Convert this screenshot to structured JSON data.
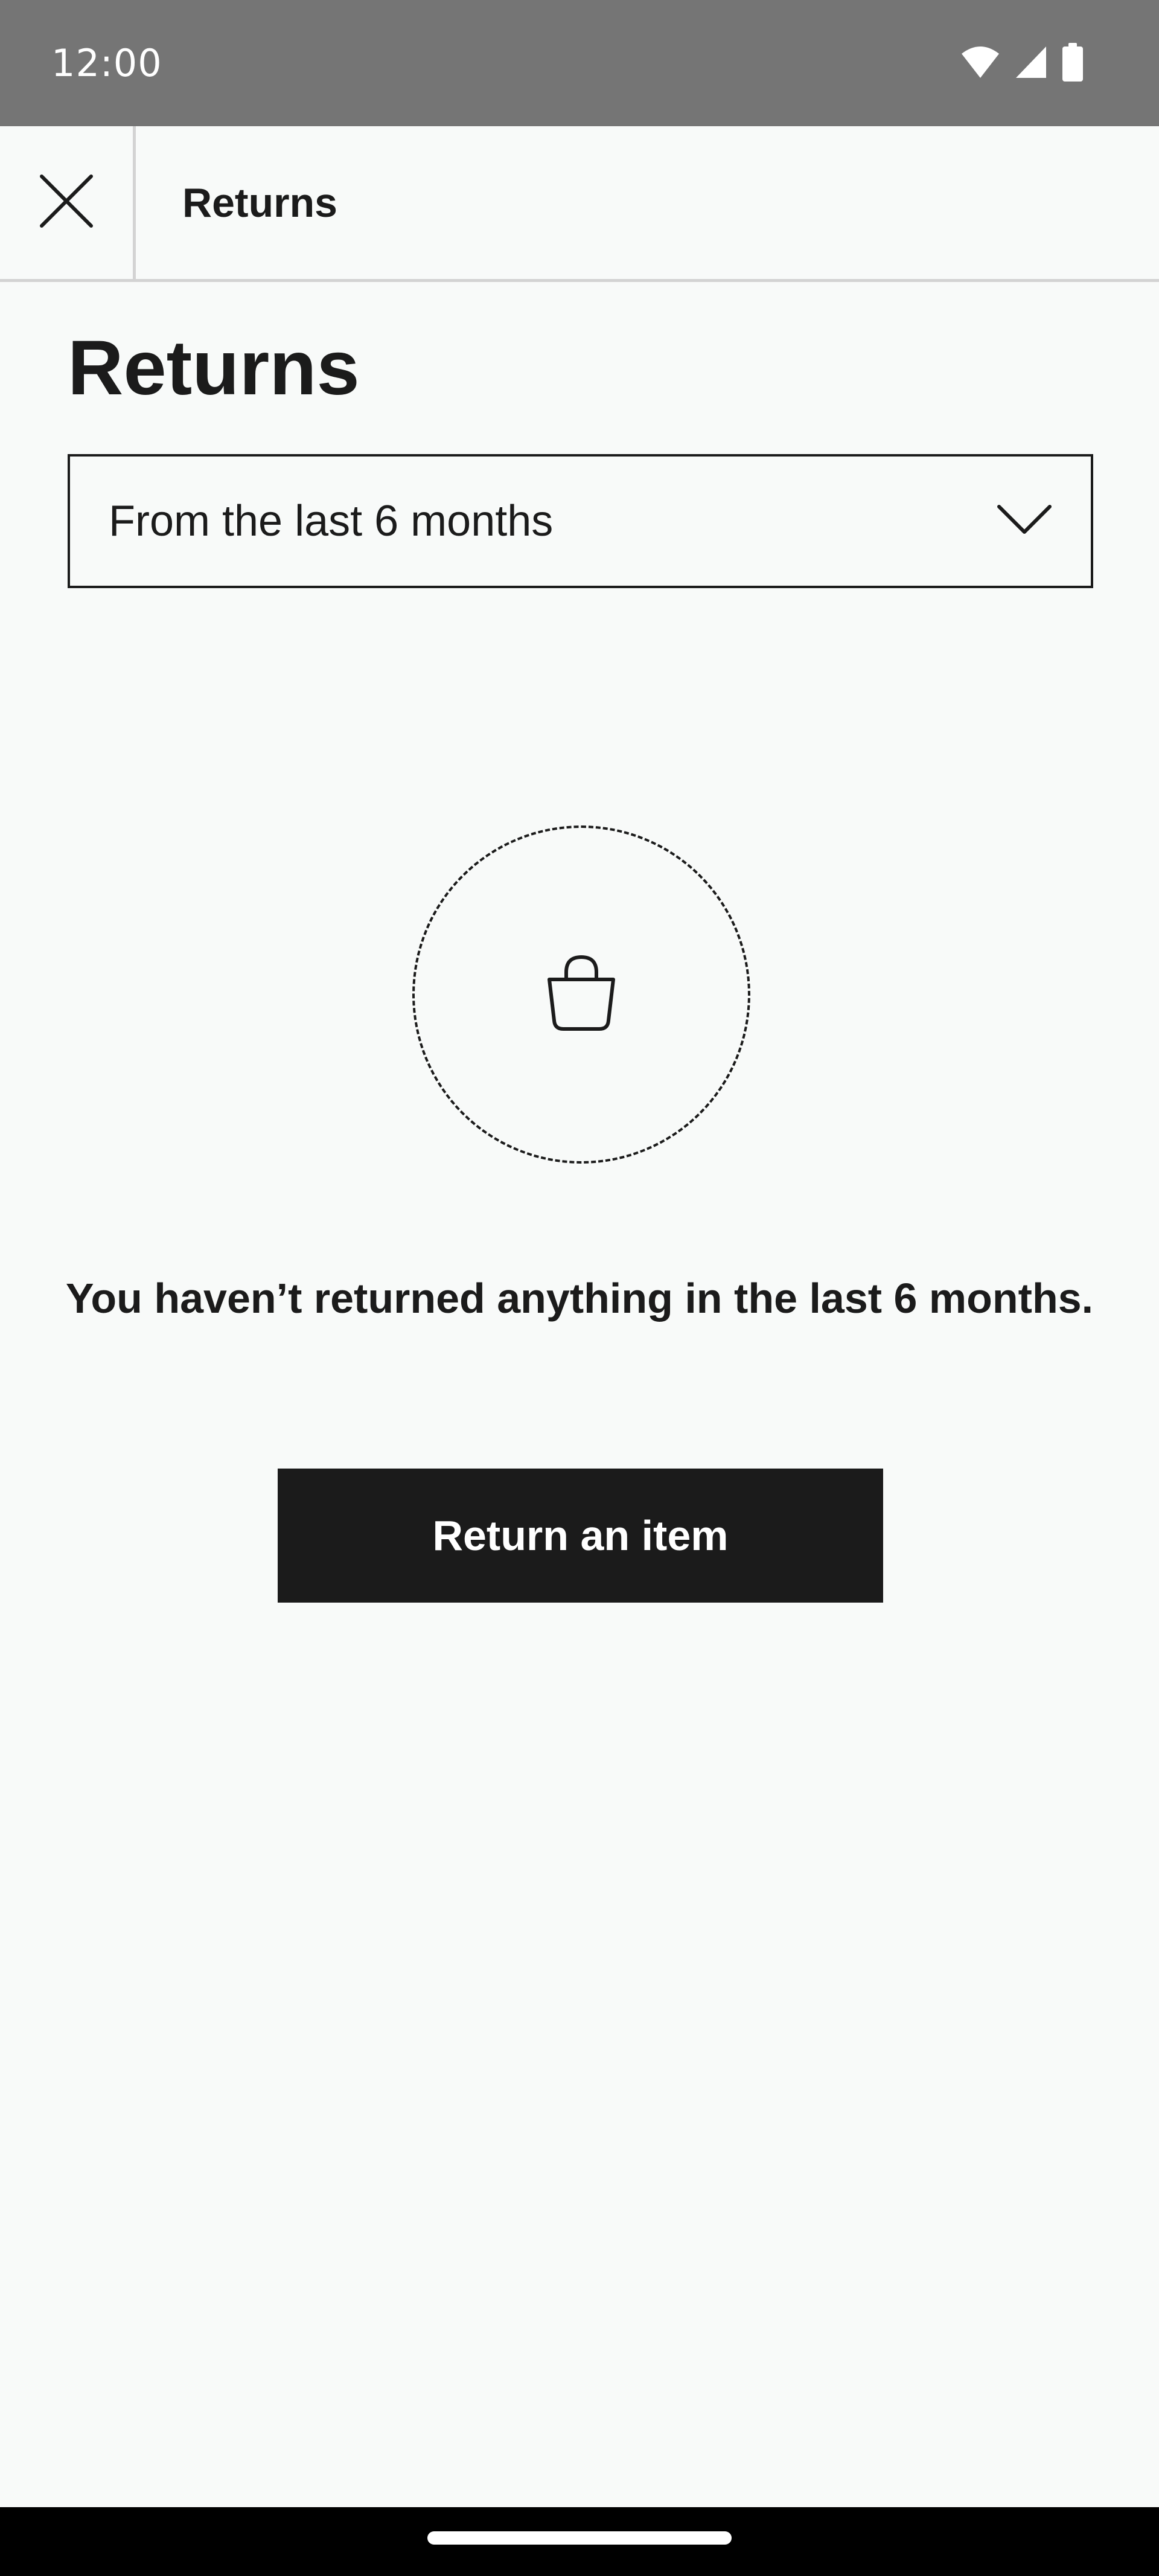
{
  "status_bar": {
    "time": "12:00",
    "icons": [
      "wifi-icon",
      "cellular-signal-icon",
      "battery-icon"
    ]
  },
  "app_bar": {
    "title": "Returns",
    "close_icon": "close-icon"
  },
  "main": {
    "title": "Returns",
    "period_select": {
      "value": "From the last 6 months",
      "icon": "chevron-down-icon"
    },
    "empty_state": {
      "icon": "shopping-bag-icon",
      "message": "You haven’t returned anything in the last 6 months."
    },
    "return_button_label": "Return an item"
  },
  "colors": {
    "background": "#f8faf9",
    "status_bar": "#757575",
    "text": "#1b1b1b",
    "button_bg": "#1b1b1b",
    "button_text": "#ffffff",
    "divider": "#d3d3d3",
    "nav_bar": "#000000"
  }
}
